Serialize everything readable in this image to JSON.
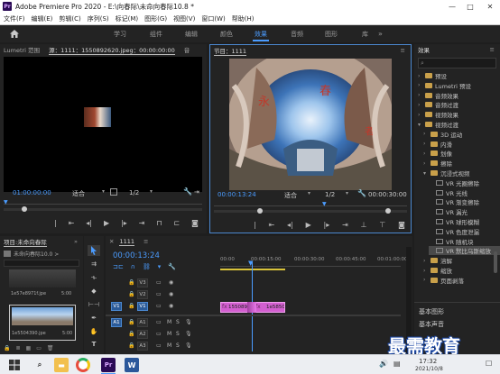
{
  "window": {
    "title": "Adobe Premiere Pro 2020 - E:\\向春际\\未命向春际10.8 *",
    "logo": "Pr",
    "controls": [
      "—",
      "□",
      "✕"
    ]
  },
  "menu": [
    "文件(F)",
    "编辑(E)",
    "剪辑(C)",
    "序列(S)",
    "标记(M)",
    "图形(G)",
    "视图(V)",
    "窗口(W)",
    "帮助(H)"
  ],
  "workspaces": [
    "学习",
    "组件",
    "编辑",
    "颜色",
    "效果",
    "音频",
    "图形",
    "库"
  ],
  "active_workspace": "效果",
  "source_panel": {
    "tabs": [
      "Lumetri 范围",
      "源：1111：1550892620.jpeg：00:00:00:00",
      "音"
    ],
    "timecode": "01:00:00:00",
    "fit": "适合",
    "ratio": "1/2"
  },
  "program_panel": {
    "tab": "节目：1111",
    "timecode": "00:00:13:24",
    "fit": "适合",
    "ratio": "1/2",
    "duration": "00:00:30:00"
  },
  "effects_panel": {
    "title": "效果",
    "items": [
      {
        "label": "预设",
        "kind": "folder",
        "level": 0,
        "open": false
      },
      {
        "label": "Lumetri 预设",
        "kind": "folder",
        "level": 0,
        "open": false
      },
      {
        "label": "音频效果",
        "kind": "folder",
        "level": 0,
        "open": false
      },
      {
        "label": "音频过渡",
        "kind": "folder",
        "level": 0,
        "open": false
      },
      {
        "label": "视频效果",
        "kind": "folder",
        "level": 0,
        "open": false
      },
      {
        "label": "视频过渡",
        "kind": "folder",
        "level": 0,
        "open": true
      },
      {
        "label": "3D 运动",
        "kind": "folder",
        "level": 1,
        "open": false
      },
      {
        "label": "内滑",
        "kind": "folder",
        "level": 1,
        "open": false
      },
      {
        "label": "划像",
        "kind": "folder",
        "level": 1,
        "open": false
      },
      {
        "label": "擦除",
        "kind": "folder",
        "level": 1,
        "open": false
      },
      {
        "label": "沉浸式视频",
        "kind": "folder",
        "level": 1,
        "open": true
      },
      {
        "label": "VR 光圈擦除",
        "kind": "fx",
        "level": 2
      },
      {
        "label": "VR 光线",
        "kind": "fx",
        "level": 2
      },
      {
        "label": "VR 渐变擦除",
        "kind": "fx",
        "level": 2
      },
      {
        "label": "VR 漏光",
        "kind": "fx",
        "level": 2
      },
      {
        "label": "VR 球形模糊",
        "kind": "fx",
        "level": 2
      },
      {
        "label": "VR 色度泄漏",
        "kind": "fx",
        "level": 2
      },
      {
        "label": "VR 随机块",
        "kind": "fx",
        "level": 2
      },
      {
        "label": "VR 默比乌斯缩放",
        "kind": "fx",
        "level": 2,
        "selected": true
      },
      {
        "label": "溶解",
        "kind": "folder",
        "level": 1,
        "open": false
      },
      {
        "label": "缩放",
        "kind": "folder",
        "level": 1,
        "open": false
      },
      {
        "label": "页面剥落",
        "kind": "folder",
        "level": 1,
        "open": false
      }
    ],
    "bottom": [
      "基本图形",
      "基本声音"
    ]
  },
  "project_panel": {
    "tab": "项目:未命向春际",
    "file": "未命向春际10.0 >",
    "items": [
      {
        "name": "1e57e8971f.jpe",
        "dur": "5:00"
      },
      {
        "name": "1e5504390.jpe",
        "dur": "5:00"
      }
    ]
  },
  "timeline": {
    "tab": "1111",
    "timecode": "00:00:13:24",
    "ruler": [
      "00:00",
      "00:00:15:00",
      "00:00:30:00",
      "00:00:45:00",
      "00:01:00:00"
    ],
    "video_tracks": [
      "V3",
      "V2",
      "V1"
    ],
    "audio_tracks": [
      "A1",
      "A2",
      "A3"
    ],
    "source_patch_video": "V1",
    "source_patch_audio": "A1",
    "clips": [
      "1550892",
      "1e5850"
    ],
    "colors": {
      "clip": "#d35fd0",
      "clip_label": "#e88ae4",
      "playhead": "#4b9cff",
      "work_area": "#d9c33a"
    }
  },
  "taskbar": {
    "time": "17:32",
    "date": "2021/10/8"
  },
  "watermark": "最需教育",
  "accent": "#4b9cff"
}
